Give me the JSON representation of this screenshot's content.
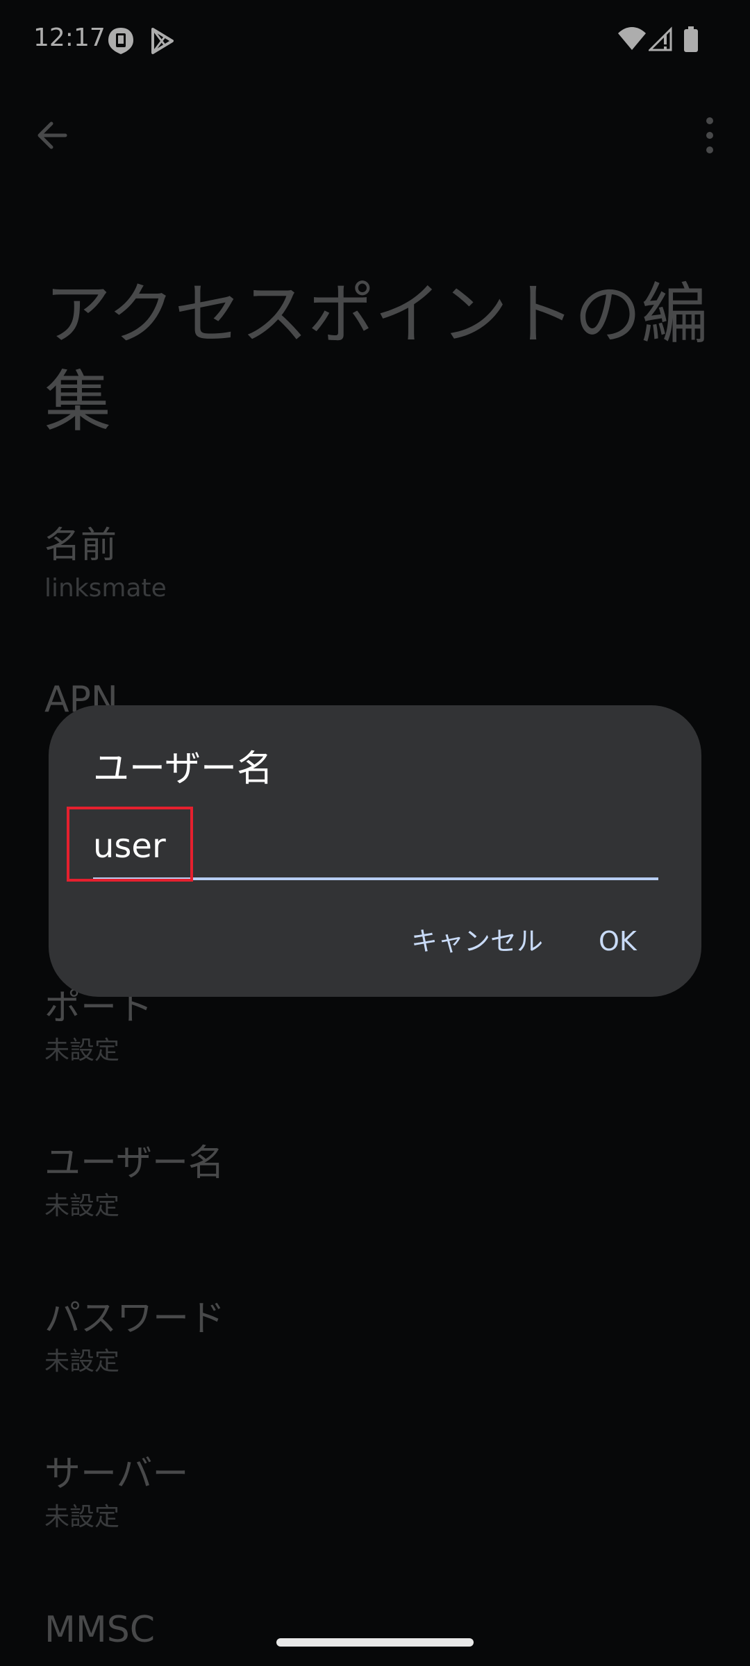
{
  "status_bar": {
    "time": "12:17",
    "icons": [
      "notification-app-icon",
      "play-store-icon",
      "wifi-icon",
      "cellular-no-signal-icon",
      "battery-icon"
    ]
  },
  "page": {
    "title": "アクセスポイントの編集"
  },
  "preferences": [
    {
      "title": "名前",
      "summary": "linksmate"
    },
    {
      "title": "APN",
      "summary": ""
    },
    {
      "title": "ポート",
      "summary": "未設定"
    },
    {
      "title": "ユーザー名",
      "summary": "未設定"
    },
    {
      "title": "パスワード",
      "summary": "未設定"
    },
    {
      "title": "サーバー",
      "summary": "未設定"
    },
    {
      "title": "MMSC",
      "summary": ""
    }
  ],
  "dialog": {
    "title": "ユーザー名",
    "input_value": "user",
    "cancel_label": "キャンセル",
    "ok_label": "OK"
  },
  "colors": {
    "background": "#0b0c0e",
    "dialog": "#323335",
    "accent": "#c9dbf7",
    "highlight": "#e5202e"
  }
}
